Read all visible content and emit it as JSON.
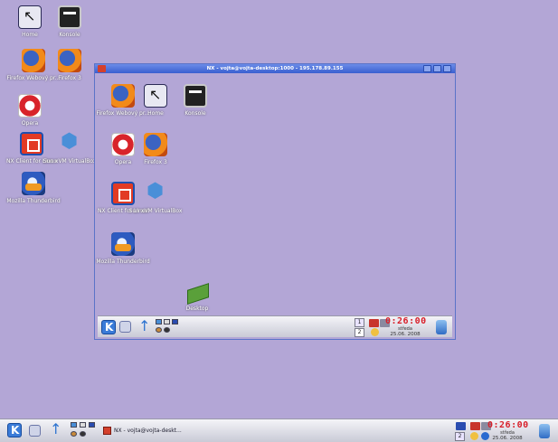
{
  "desktop": {
    "icons": [
      {
        "name": "home-icon",
        "label": "Home"
      },
      {
        "name": "konsole-icon",
        "label": "Konsole"
      },
      {
        "name": "firefox-icon",
        "label": "Firefox Webový pr..."
      },
      {
        "name": "firefox-icon",
        "label": "Firefox 3"
      },
      {
        "name": "opera-icon",
        "label": "Opera"
      },
      {
        "name": "xnx-icon",
        "label": "NX Client for Linux"
      },
      {
        "name": "virtualbox-icon",
        "label": "Sun xVM VirtualBox"
      },
      {
        "name": "thunderbird-icon",
        "label": "Mozilla Thunderbird"
      }
    ]
  },
  "nx_window": {
    "title": "NX - vojta@vojta-desktop:1000 - 195.178.89.155",
    "icons": [
      {
        "name": "firefox-icon",
        "label": "Firefox Webový pr..."
      },
      {
        "name": "home-icon",
        "label": "Home"
      },
      {
        "name": "konsole-icon",
        "label": "Konsole"
      },
      {
        "name": "opera-icon",
        "label": "Opera"
      },
      {
        "name": "firefox-icon",
        "label": "Firefox 3"
      },
      {
        "name": "xnx-icon",
        "label": "NX Client for Linux"
      },
      {
        "name": "virtualbox-icon",
        "label": "Sun xVM VirtualBox"
      },
      {
        "name": "thunderbird-icon",
        "label": "Mozilla Thunderbird"
      },
      {
        "name": "books-icon",
        "label": "Desktop"
      }
    ],
    "panel": {
      "pager": [
        "1",
        "2"
      ],
      "clock_time": "0:26:00",
      "clock_day": "středa",
      "clock_date": "25.06. 2008"
    }
  },
  "taskbar": {
    "task_label": "NX - vojta@vojta-deskt...",
    "pager": [
      "1",
      "2"
    ],
    "clock_time": "0:26:00",
    "clock_day": "středa",
    "clock_date": "25.06. 2008"
  },
  "colors": {
    "desktop_bg": "#b3a6d6",
    "titlebar": "#3a5fd0",
    "clock": "#d8202a"
  }
}
